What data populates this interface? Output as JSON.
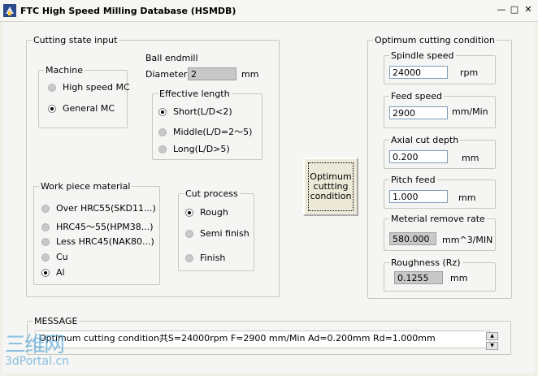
{
  "window": {
    "title": "FTC High Speed Milling Database (HSMDB)",
    "minimize_label": "—",
    "maximize_label": "□",
    "close_label": "✕"
  },
  "cutting_state": {
    "legend": "Cutting state input",
    "machine": {
      "legend": "Machine",
      "options": [
        "High speed MC",
        "General MC"
      ],
      "selected": "General MC"
    },
    "ball_endmill": {
      "legend": "Ball endmill",
      "diameter_label": "Diameter",
      "diameter_value": "2",
      "diameter_unit": "mm",
      "effective_length": {
        "legend": "Effective length",
        "options": [
          "Short(L/D<2)",
          "Middle(L/D=2～5)",
          "Long(L/D>5)"
        ],
        "selected": "Short(L/D<2)"
      }
    },
    "work_piece": {
      "legend": "Work piece material",
      "options": [
        "Over HRC55(SKD11...)",
        "HRC45～55(HPM38...)",
        "Less HRC45(NAK80...)",
        "Cu",
        "Al"
      ],
      "selected": "Al"
    },
    "cut_process": {
      "legend": "Cut process",
      "options": [
        "Rough",
        "Semi finish",
        "Finish"
      ],
      "selected": "Rough"
    }
  },
  "optimum_button": {
    "line1": "Optimum",
    "line2": "cuttting",
    "line3": "condition"
  },
  "optimum": {
    "legend": "Optimum cutting condition",
    "spindle": {
      "legend": "Spindle speed",
      "value": "24000",
      "unit": "rpm"
    },
    "feed": {
      "legend": "Feed speed",
      "value": "2900",
      "unit": "mm/Min"
    },
    "axial": {
      "legend": "Axial cut depth",
      "value": "0.200",
      "unit": "mm"
    },
    "pitch": {
      "legend": "Pitch feed",
      "value": "1.000",
      "unit": "mm"
    },
    "removal": {
      "legend": "Meterial remove rate",
      "value": "580.000",
      "unit": "mm^3/MIN"
    },
    "roughness": {
      "legend": "Roughness (Rz)",
      "value": "0.1255",
      "unit": "mm"
    }
  },
  "message": {
    "legend": "MESSAGE",
    "text": "Optimum cutting condition共S=24000rpm F=2900 mm/Min Ad=0.200mm Rd=1.000mm"
  },
  "watermark": {
    "line1": "三维网",
    "line2": "3dPortal.cn"
  }
}
